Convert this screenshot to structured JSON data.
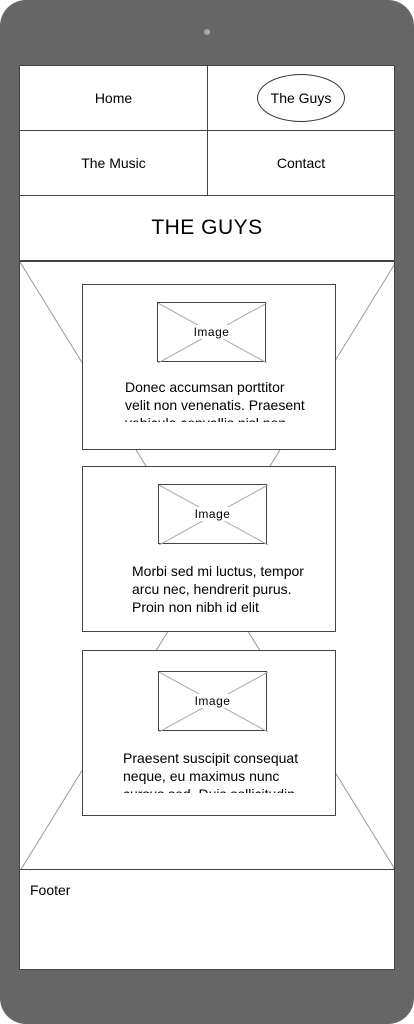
{
  "nav": {
    "home": "Home",
    "the_guys": "The Guys",
    "the_music": "The Music",
    "contact": "Contact"
  },
  "page_title": "THE GUYS",
  "cards": [
    {
      "image_label": "Image",
      "text": "Donec accumsan porttitor velit non venenatis. Praesent vehicula convallis nisl non"
    },
    {
      "image_label": "Image",
      "text": "Morbi sed mi luctus, tempor arcu nec, hendrerit purus. Proin non nibh id elit"
    },
    {
      "image_label": "Image",
      "text": "Praesent suscipit consequat neque, eu maximus nunc cursus sed. Duis sollicitudin"
    }
  ],
  "footer": {
    "label": "Footer"
  },
  "colors": {
    "frame": "#666666",
    "screen": "#ffffff",
    "wire": "#444444"
  }
}
